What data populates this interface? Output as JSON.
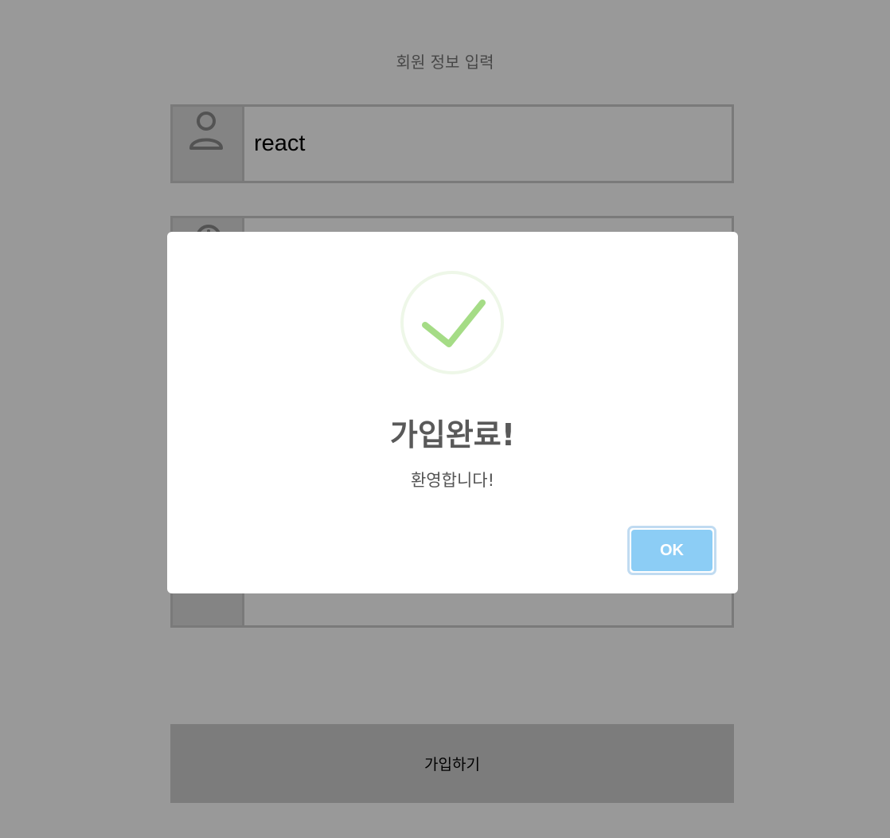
{
  "form": {
    "title": "회원 정보 입력",
    "fields": [
      {
        "icon": "user-icon",
        "value": "react"
      },
      {
        "icon": "clock-icon",
        "value": ""
      },
      {
        "icon": "",
        "value": ""
      }
    ],
    "submit_label": "가입하기"
  },
  "modal": {
    "icon": "success-check-icon",
    "title": "가입완료!",
    "text": "환영합니다!",
    "ok_label": "OK",
    "colors": {
      "check": "#a5dc86",
      "check_ring": "#eef7e8",
      "ok_button": "#8ccdf5"
    }
  },
  "colors": {
    "overlay": "rgba(0,0,0,0.4)"
  }
}
